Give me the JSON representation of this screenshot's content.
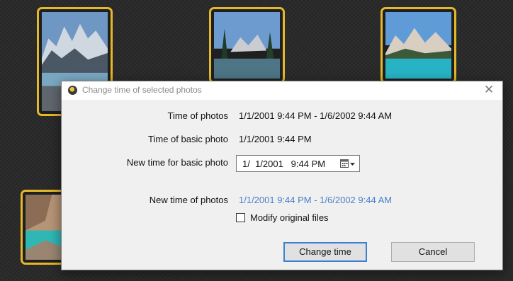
{
  "dialog": {
    "title": "Change time of selected photos",
    "close_glyph": "✕",
    "rows": {
      "time_of_photos": {
        "label": "Time of photos",
        "value": "1/1/2001 9:44 PM - 1/6/2002 9:44 AM"
      },
      "time_of_basic_photo": {
        "label": "Time of basic photo",
        "value": "1/1/2001 9:44 PM"
      },
      "new_time_basic": {
        "label": "New time for basic photo",
        "value": "1/  1/2001   9:44 PM"
      },
      "new_time_of_photos": {
        "label": "New time of photos",
        "value": "1/1/2001 9:44 PM - 1/6/2002 9:44 AM"
      }
    },
    "modify_original": {
      "label": "Modify original files",
      "checked": false
    },
    "buttons": {
      "change_time": "Change time",
      "cancel": "Cancel"
    }
  },
  "colors": {
    "accent": "#3c80d6",
    "highlight_text": "#4a7fc8",
    "thumb_border": "#e3b82a"
  },
  "icons": {
    "app": "app-logo-icon",
    "close": "close-icon",
    "calendar": "calendar-dropdown-icon"
  }
}
